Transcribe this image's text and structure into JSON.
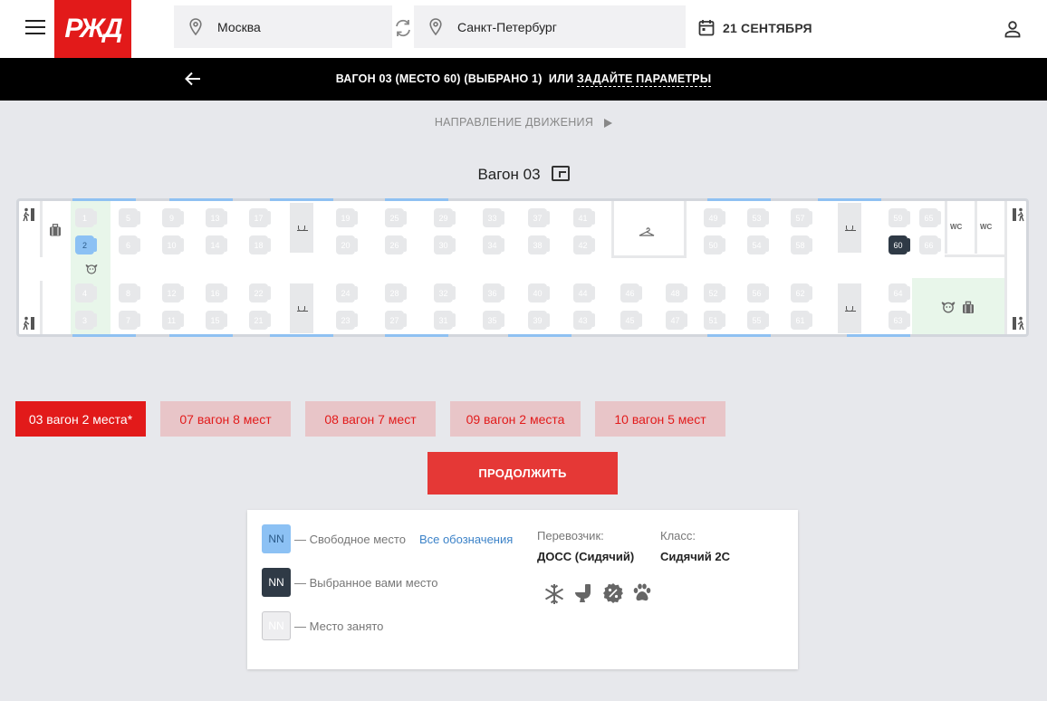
{
  "header": {
    "logo_text": "РЖД",
    "from": "Москва",
    "to": "Санкт-Петербург",
    "date": "21 СЕНТЯБРЯ"
  },
  "selection_bar": {
    "text": "ВАГОН 03 (МЕСТО 60) (ВЫБРАНО 1)",
    "or": "ИЛИ",
    "link": "ЗАДАЙТЕ ПАРАМЕТРЫ"
  },
  "direction": "НАПРАВЛЕНИЕ ДВИЖЕНИЯ",
  "wagon_title": "Вагон 03",
  "car": {
    "wc_label": "WC",
    "free_seat": "2",
    "selected_seat": "60",
    "top_row1": [
      "1",
      "5",
      "9",
      "13",
      "17",
      "19",
      "25",
      "29",
      "33",
      "37",
      "41",
      "49",
      "53",
      "57",
      "59",
      "65"
    ],
    "top_row2": [
      "2",
      "6",
      "10",
      "14",
      "18",
      "20",
      "26",
      "30",
      "34",
      "38",
      "42",
      "50",
      "54",
      "58",
      "60",
      "66"
    ],
    "bottom_row1": [
      "4",
      "8",
      "12",
      "16",
      "22",
      "24",
      "28",
      "32",
      "36",
      "40",
      "44",
      "46",
      "48",
      "52",
      "56",
      "62",
      "64"
    ],
    "bottom_row2": [
      "3",
      "7",
      "11",
      "15",
      "21",
      "23",
      "27",
      "31",
      "35",
      "39",
      "43",
      "45",
      "47",
      "51",
      "55",
      "61",
      "63"
    ]
  },
  "wagons": [
    {
      "label": "03 вагон 2 места*",
      "active": true
    },
    {
      "label": "07 вагон 8 мест",
      "active": false
    },
    {
      "label": "08 вагон 7 мест",
      "active": false
    },
    {
      "label": "09 вагон 2 места",
      "active": false
    },
    {
      "label": "10 вагон 5 мест",
      "active": false
    }
  ],
  "continue_label": "ПРОДОЛЖИТЬ",
  "legend": {
    "nn": "NN",
    "free": "— Свободное место",
    "all_link": "Все обозначения",
    "selected": "— Выбранное вами место",
    "busy": "— Место занято",
    "carrier_label": "Перевозчик:",
    "carrier_value": "ДОСС (Сидячий)",
    "class_label": "Класс:",
    "class_value": "Сидячий 2С",
    "amenities": [
      "snowflake-icon",
      "toilet-icon",
      "discount-icon",
      "pet-icon"
    ]
  },
  "colors": {
    "brand_red": "#e21a1a",
    "free_seat": "#8cc1f4",
    "selected_seat": "#2f3a46"
  }
}
